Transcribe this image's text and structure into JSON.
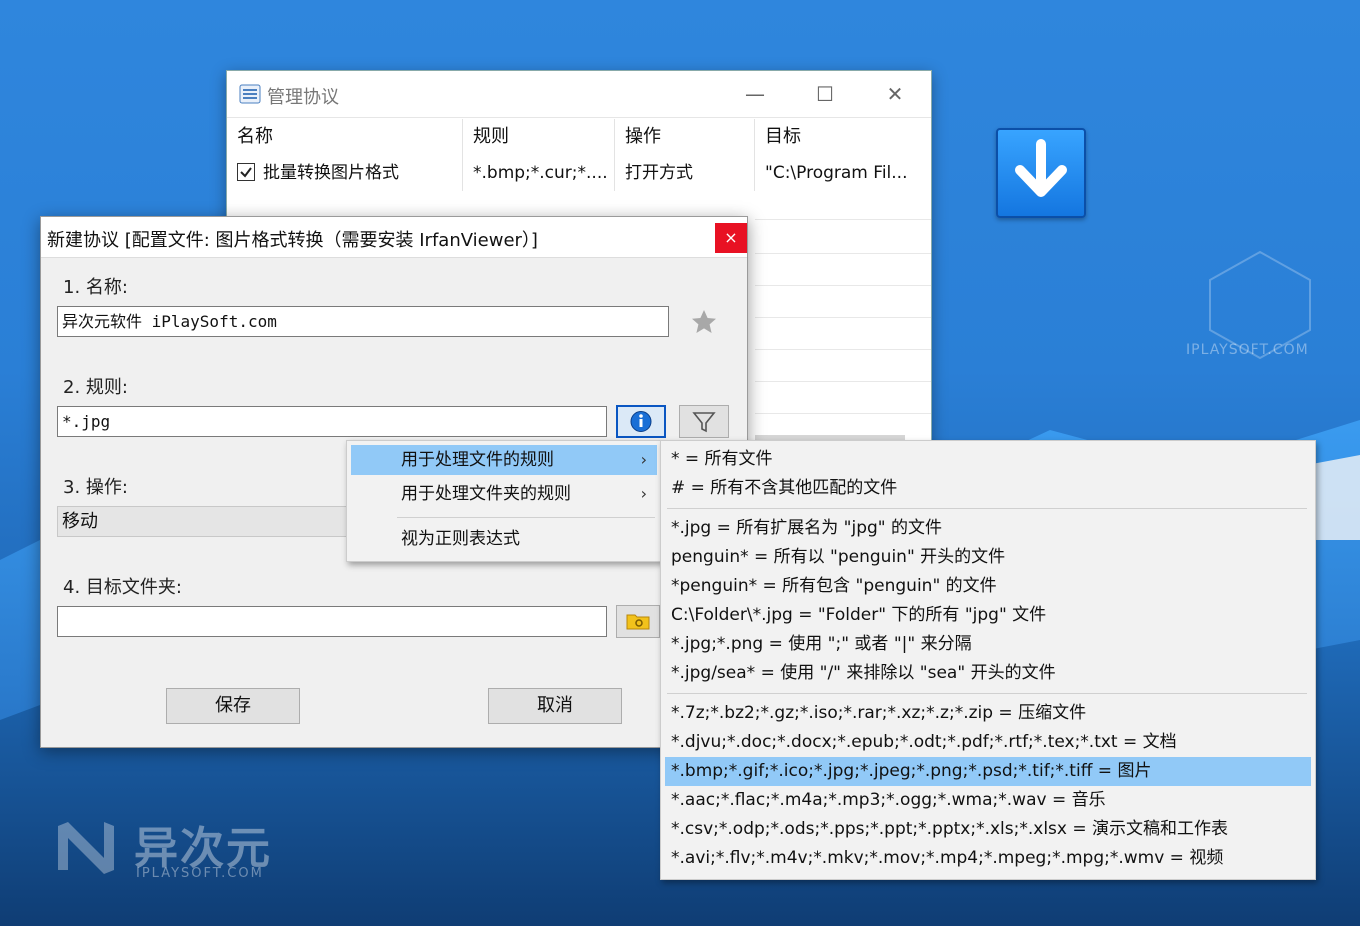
{
  "back_window": {
    "title": "管理协议",
    "controls": {
      "minimize": "—",
      "maximize": "☐",
      "close": "✕"
    },
    "columns": [
      "名称",
      "规则",
      "操作",
      "目标"
    ],
    "rows": [
      {
        "checked": true,
        "name": "批量转换图片格式",
        "rule": "*.bmp;*.cur;*....",
        "action": "打开方式",
        "target": "\"C:\\Program Fil..."
      }
    ]
  },
  "dialog": {
    "title": "新建协议 [配置文件: 图片格式转换（需要安装 IrfanViewer）]",
    "close": "×",
    "name_label": "1.  名称:",
    "name_value": "异次元软件 iPlaySoft.com",
    "rule_label": "2.  规则:",
    "rule_value": "*.jpg",
    "action_label": "3.  操作:",
    "action_value": "移动",
    "target_label": "4.  目标文件夹:",
    "target_value": "",
    "save": "保存",
    "cancel": "取消"
  },
  "menu_main": [
    {
      "label": "用于处理文件的规则",
      "arrow": "›"
    },
    {
      "label": "用于处理文件夹的规则",
      "arrow": "›"
    },
    {
      "label": "视为正则表达式"
    }
  ],
  "menu_sub": {
    "group1": [
      "* = 所有文件",
      "# = 所有不含其他匹配的文件"
    ],
    "group2": [
      "*.jpg = 所有扩展名为 \"jpg\" 的文件",
      "penguin* = 所有以 \"penguin\" 开头的文件",
      "*penguin* = 所有包含 \"penguin\" 的文件",
      "C:\\Folder\\*.jpg = \"Folder\" 下的所有 \"jpg\" 文件",
      "*.jpg;*.png = 使用 \";\" 或者 \"|\" 来分隔",
      "*.jpg/sea* = 使用 \"/\" 来排除以 \"sea\" 开头的文件"
    ],
    "group3": [
      "*.7z;*.bz2;*.gz;*.iso;*.rar;*.xz;*.z;*.zip = 压缩文件",
      "*.djvu;*.doc;*.docx;*.epub;*.odt;*.pdf;*.rtf;*.tex;*.txt = 文档",
      "*.bmp;*.gif;*.ico;*.jpg;*.jpeg;*.png;*.psd;*.tif;*.tiff = 图片",
      "*.aac;*.flac;*.m4a;*.mp3;*.ogg;*.wma;*.wav = 音乐",
      "*.csv;*.odp;*.ods;*.pps;*.ppt;*.pptx;*.xls;*.xlsx = 演示文稿和工作表",
      "*.avi;*.flv;*.m4v;*.mkv;*.mov;*.mp4;*.mpeg;*.mpg;*.wmv = 视频"
    ]
  },
  "watermarks": {
    "site_top": "IPLAYSOFT.COM",
    "logo_cn": "异次元",
    "logo_en": "IPLAYSOFT.COM"
  },
  "colors": {
    "highlight": "#91c9f7",
    "close_red": "#e81123",
    "accent_blue": "#0a56c2"
  }
}
